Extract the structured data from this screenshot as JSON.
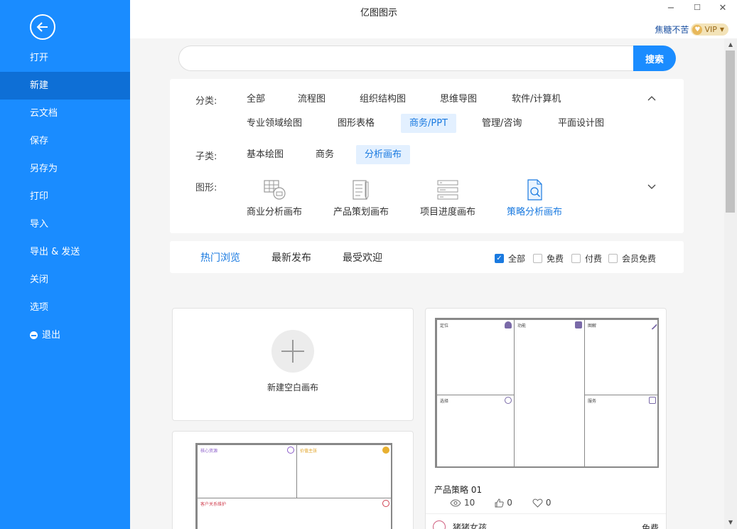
{
  "sidebar": {
    "items": [
      {
        "label": "打开"
      },
      {
        "label": "新建"
      },
      {
        "label": "云文档"
      },
      {
        "label": "保存"
      },
      {
        "label": "另存为"
      },
      {
        "label": "打印"
      },
      {
        "label": "导入"
      },
      {
        "label": "导出 & 发送"
      },
      {
        "label": "关闭"
      },
      {
        "label": "选项"
      },
      {
        "label": "退出"
      }
    ],
    "active_index": 1
  },
  "titlebar": {
    "title": "亿图图示",
    "minimize": "−",
    "maximize": "☐",
    "close": "✕",
    "username": "焦糖不苦",
    "vip": "VIP"
  },
  "search": {
    "value": "",
    "placeholder": "",
    "button": "搜索"
  },
  "filters": {
    "category_label": "分类:",
    "categories": [
      "全部",
      "流程图",
      "组织结构图",
      "思维导图",
      "软件/计算机",
      "专业领域绘图",
      "图形表格",
      "商务/PPT",
      "管理/咨询",
      "平面设计图"
    ],
    "subcategory_label": "子类:",
    "subcategories": [
      "基本绘图",
      "商务",
      "分析画布"
    ],
    "shape_label": "图形:",
    "shapes": [
      "商业分析画布",
      "产品策划画布",
      "项目进度画布",
      "策略分析画布"
    ]
  },
  "sort_tabs": [
    "热门浏览",
    "最新发布",
    "最受欢迎"
  ],
  "price_filters": [
    {
      "label": "全部",
      "checked": true
    },
    {
      "label": "免费",
      "checked": false
    },
    {
      "label": "付费",
      "checked": false
    },
    {
      "label": "会员免费",
      "checked": false
    }
  ],
  "new_blank": {
    "label": "新建空白画布"
  },
  "template_left": {
    "cells": [
      "核心资源",
      "价值主张",
      "客户关系维护"
    ]
  },
  "template_right": {
    "cells": [
      "定位",
      "功能",
      "图解",
      "选择",
      "服务"
    ],
    "title": "产品策略 01",
    "views": "10",
    "likes": "0",
    "favorites": "0",
    "author": "猪猪女孩",
    "price": "免费"
  },
  "colors": {
    "brand": "#1a8cff",
    "accent": "#1a7ae0",
    "selected_bg": "#e3f0ff"
  }
}
